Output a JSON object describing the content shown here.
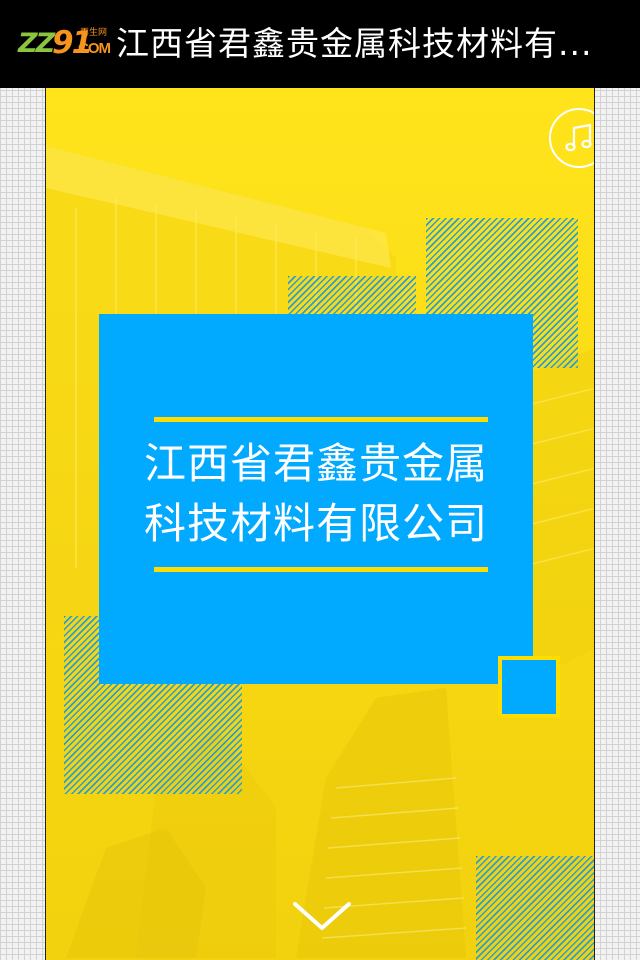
{
  "header": {
    "logo": {
      "zz": "ZZ",
      "nn": "91",
      "small": "再生网",
      "com": "COM"
    },
    "title": "江西省君鑫贵金属科技材料有..."
  },
  "main": {
    "company_name_line1": "江西省君鑫贵金属",
    "company_name_line2": "科技材料有限公司",
    "music_icon": "music-note-icon",
    "scroll_icon": "chevron-down-icon"
  },
  "colors": {
    "background_yellow": "#ffe41c",
    "panel_blue": "#01a9ff",
    "accent_yellow": "#ffdd00",
    "stripe_blue": "#2a9fd6"
  }
}
